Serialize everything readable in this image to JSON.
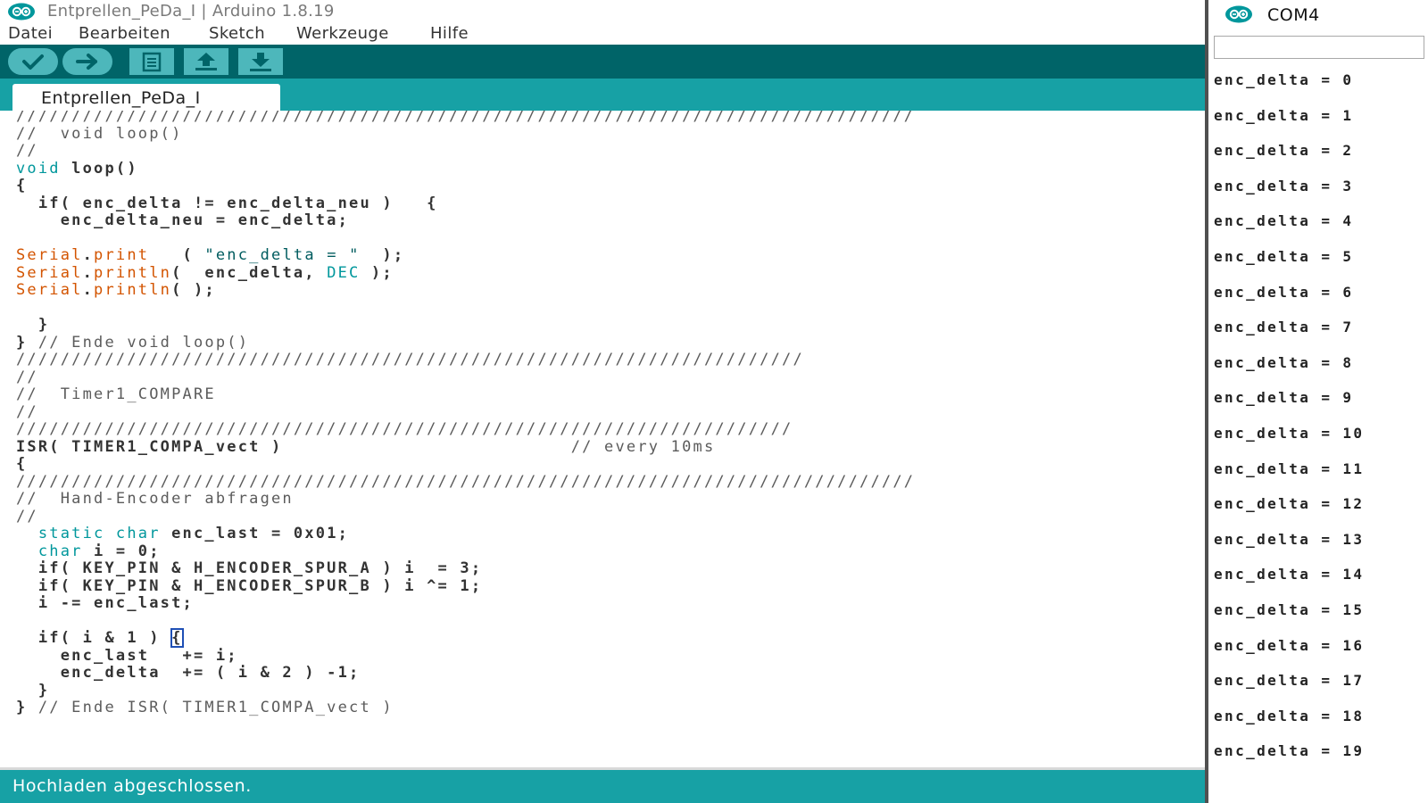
{
  "window": {
    "title": "Entprellen_PeDa_I | Arduino 1.8.19"
  },
  "menu": [
    "Datei",
    "Bearbeiten",
    "Sketch",
    "Werkzeuge",
    "Hilfe"
  ],
  "toolbar": {
    "buttons": [
      {
        "name": "verify",
        "icon": "checkmark-icon"
      },
      {
        "name": "upload",
        "icon": "arrow-right-icon"
      },
      {
        "name": "new",
        "icon": "document-icon"
      },
      {
        "name": "open",
        "icon": "arrow-up-icon"
      },
      {
        "name": "save",
        "icon": "arrow-down-icon"
      }
    ]
  },
  "tab": {
    "label": "Entprellen_PeDa_I"
  },
  "code": [
    [
      [
        "c-cm",
        "/////////////////////////////////////////////////////////////////////////////////"
      ]
    ],
    [
      [
        "c-cm",
        "//  void loop()"
      ]
    ],
    [
      [
        "c-cm",
        "//"
      ]
    ],
    [
      [
        "c-kw",
        "void"
      ],
      [
        "",
        " loop()"
      ]
    ],
    [
      [
        "",
        "{"
      ]
    ],
    [
      [
        "",
        "  if( enc_delta != enc_delta_neu )   {"
      ]
    ],
    [
      [
        "",
        "    enc_delta_neu = enc_delta;"
      ]
    ],
    [
      [
        "",
        ""
      ]
    ],
    [
      [
        "c-ser",
        "Serial"
      ],
      [
        "",
        "."
      ],
      [
        "c-ser",
        "print"
      ],
      [
        "",
        "   ( "
      ],
      [
        "c-str",
        "\"enc_delta = \""
      ],
      [
        "",
        "  );"
      ]
    ],
    [
      [
        "c-ser",
        "Serial"
      ],
      [
        "",
        "."
      ],
      [
        "c-ser",
        "println"
      ],
      [
        "",
        "(  enc_delta, "
      ],
      [
        "c-kw",
        "DEC"
      ],
      [
        "",
        " );"
      ]
    ],
    [
      [
        "c-ser",
        "Serial"
      ],
      [
        "",
        "."
      ],
      [
        "c-ser",
        "println"
      ],
      [
        "",
        "( );"
      ]
    ],
    [
      [
        "",
        ""
      ]
    ],
    [
      [
        "",
        "  }"
      ]
    ],
    [
      [
        "",
        "} "
      ],
      [
        "c-cm",
        "// Ende void loop()"
      ]
    ],
    [
      [
        "c-cm",
        "///////////////////////////////////////////////////////////////////////"
      ]
    ],
    [
      [
        "c-cm",
        "//"
      ]
    ],
    [
      [
        "c-cm",
        "//  Timer1_COMPARE"
      ]
    ],
    [
      [
        "c-cm",
        "//"
      ]
    ],
    [
      [
        "c-cm",
        "//////////////////////////////////////////////////////////////////////"
      ]
    ],
    [
      [
        "",
        "ISR( TIMER1_COMPA_vect )                          "
      ],
      [
        "c-cm",
        "// every 10ms"
      ]
    ],
    [
      [
        "",
        "{"
      ]
    ],
    [
      [
        "c-cm",
        "/////////////////////////////////////////////////////////////////////////////////"
      ]
    ],
    [
      [
        "c-cm",
        "//  Hand-Encoder abfragen"
      ]
    ],
    [
      [
        "c-cm",
        "//"
      ]
    ],
    [
      [
        "",
        "  "
      ],
      [
        "c-kw",
        "static"
      ],
      [
        "",
        " "
      ],
      [
        "c-kw",
        "char"
      ],
      [
        "",
        " enc_last = 0x01;"
      ]
    ],
    [
      [
        "",
        "  "
      ],
      [
        "c-kw",
        "char"
      ],
      [
        "",
        " i = 0;"
      ]
    ],
    [
      [
        "",
        "  if( KEY_PIN & H_ENCODER_SPUR_A ) i  = 3;"
      ]
    ],
    [
      [
        "",
        "  if( KEY_PIN & H_ENCODER_SPUR_B ) i ^= 1;"
      ]
    ],
    [
      [
        "",
        "  i -= enc_last;"
      ]
    ],
    [
      [
        "",
        ""
      ]
    ],
    [
      [
        "",
        "  if( i & 1 ) "
      ],
      [
        "c-br",
        "{"
      ]
    ],
    [
      [
        "",
        "    enc_last   += i;"
      ]
    ],
    [
      [
        "",
        "    enc_delta  += ( i & 2 ) -1;"
      ]
    ],
    [
      [
        "",
        "  }"
      ]
    ],
    [
      [
        "",
        "} "
      ],
      [
        "c-cm",
        "// Ende ISR( TIMER1_COMPA_vect )"
      ]
    ]
  ],
  "status": {
    "message": "Hochladen abgeschlossen."
  },
  "serial_monitor": {
    "port": "COM4",
    "input_value": "",
    "lines": [
      "enc_delta = 0",
      "enc_delta = 1",
      "enc_delta = 2",
      "enc_delta = 3",
      "enc_delta = 4",
      "enc_delta = 5",
      "enc_delta = 6",
      "enc_delta = 7",
      "enc_delta = 8",
      "enc_delta = 9",
      "enc_delta = 10",
      "enc_delta = 11",
      "enc_delta = 12",
      "enc_delta = 13",
      "enc_delta = 14",
      "enc_delta = 15",
      "enc_delta = 16",
      "enc_delta = 17",
      "enc_delta = 18",
      "enc_delta = 19"
    ]
  },
  "colors": {
    "toolbar_bg": "#006468",
    "accent_teal": "#17a1a5",
    "button_teal": "#4db7bb",
    "keyword": "#00979c",
    "serial_class": "#d35400"
  }
}
